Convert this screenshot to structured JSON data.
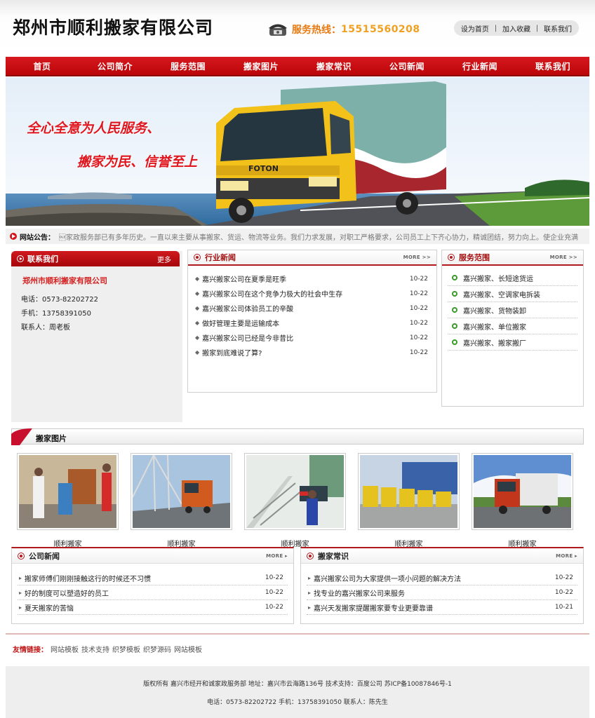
{
  "header": {
    "logo": "郑州市顺利搬家有限公司",
    "hotline_label": "服务热线：",
    "hotline_number": "15515560208",
    "links": [
      "设为首页",
      "加入收藏",
      "联系我们"
    ]
  },
  "nav": [
    "首页",
    "公司简介",
    "服务范围",
    "搬家图片",
    "搬家常识",
    "公司新闻",
    "行业新闻",
    "联系我们"
  ],
  "banner": {
    "slogan1": "全心全意为人民服务、",
    "slogan2": "搬家为民、信誉至上",
    "truck_brand": "FOTON"
  },
  "notice": {
    "label": "网站公告：",
    "text": "\u0010家政服务部已有多年历史。一直以来主要从事搬家、货运、物流等业务。我们力求发展，对职工严格要求，公司员工上下齐心协力，精诚团结，努力向上。使企业充满"
  },
  "contact": {
    "title": "联系我们",
    "more": "更多",
    "company": "郑州市顺利搬家有限公司",
    "phone": "电话：0573-82202722",
    "mobile": "手机：13758391050",
    "person": "联系人：周老板"
  },
  "industry_news": {
    "title": "行业新闻",
    "more": "MORE >>",
    "items": [
      {
        "title": "嘉兴搬家公司在夏季是旺季",
        "date": "10-22"
      },
      {
        "title": "嘉兴搬家公司在这个竞争力极大的社会中生存",
        "date": "10-22"
      },
      {
        "title": "嘉兴搬家公司体验员工的辛酸",
        "date": "10-22"
      },
      {
        "title": "做好管理主要是运输成本",
        "date": "10-22"
      },
      {
        "title": "嘉兴搬家公司已经是今非昔比",
        "date": "10-22"
      },
      {
        "title": "搬家到底难说了算?",
        "date": "10-22"
      }
    ]
  },
  "services": {
    "title": "服务范围",
    "more": "MORE >>",
    "items": [
      "嘉兴搬家、长短途货运",
      "嘉兴搬家、空调家电拆装",
      "嘉兴搬家、货物装卸",
      "嘉兴搬家、单位搬家",
      "嘉兴搬家、搬家搬厂"
    ]
  },
  "photos": {
    "title": "搬家图片",
    "items": [
      {
        "caption": "顺利搬家"
      },
      {
        "caption": "顺利搬家"
      },
      {
        "caption": "顺利搬家"
      },
      {
        "caption": "顺利搬家"
      },
      {
        "caption": "顺利搬家"
      }
    ]
  },
  "company_news": {
    "title": "公司新闻",
    "more": "MORE ▸",
    "items": [
      {
        "title": "搬家师傅们刚刚接触这行的时候还不习惯",
        "date": "10-22"
      },
      {
        "title": "好的制度可以塑造好的员工",
        "date": "10-22"
      },
      {
        "title": "夏天搬家的苦恼",
        "date": "10-22"
      }
    ]
  },
  "tips": {
    "title": "搬家常识",
    "more": "MORE ▸",
    "items": [
      {
        "title": "嘉兴搬家公司为大家提供一项小问题的解决方法",
        "date": "10-22"
      },
      {
        "title": "找专业的嘉兴搬家公司来服务",
        "date": "10-22"
      },
      {
        "title": "嘉兴天发搬家提醒搬家要专业更要靠谱",
        "date": "10-21"
      }
    ]
  },
  "friend_links": {
    "label": "友情链接：",
    "items": [
      "网站模板",
      "技术支持",
      "织梦模板",
      "织梦源码",
      "网站模板"
    ]
  },
  "footer": {
    "line1": "版权所有  嘉兴市经开和诚家政服务部  地址：嘉兴市云海路136号  技术支持：百度公司  苏ICP备10087846号-1",
    "line2": "电话：0573-82202722  手机：13758391050  联系人：陈先生"
  },
  "colors": {
    "brand_red": "#c8102e",
    "hotline_orange": "#e87a12",
    "service_green": "#3a9a2a"
  }
}
